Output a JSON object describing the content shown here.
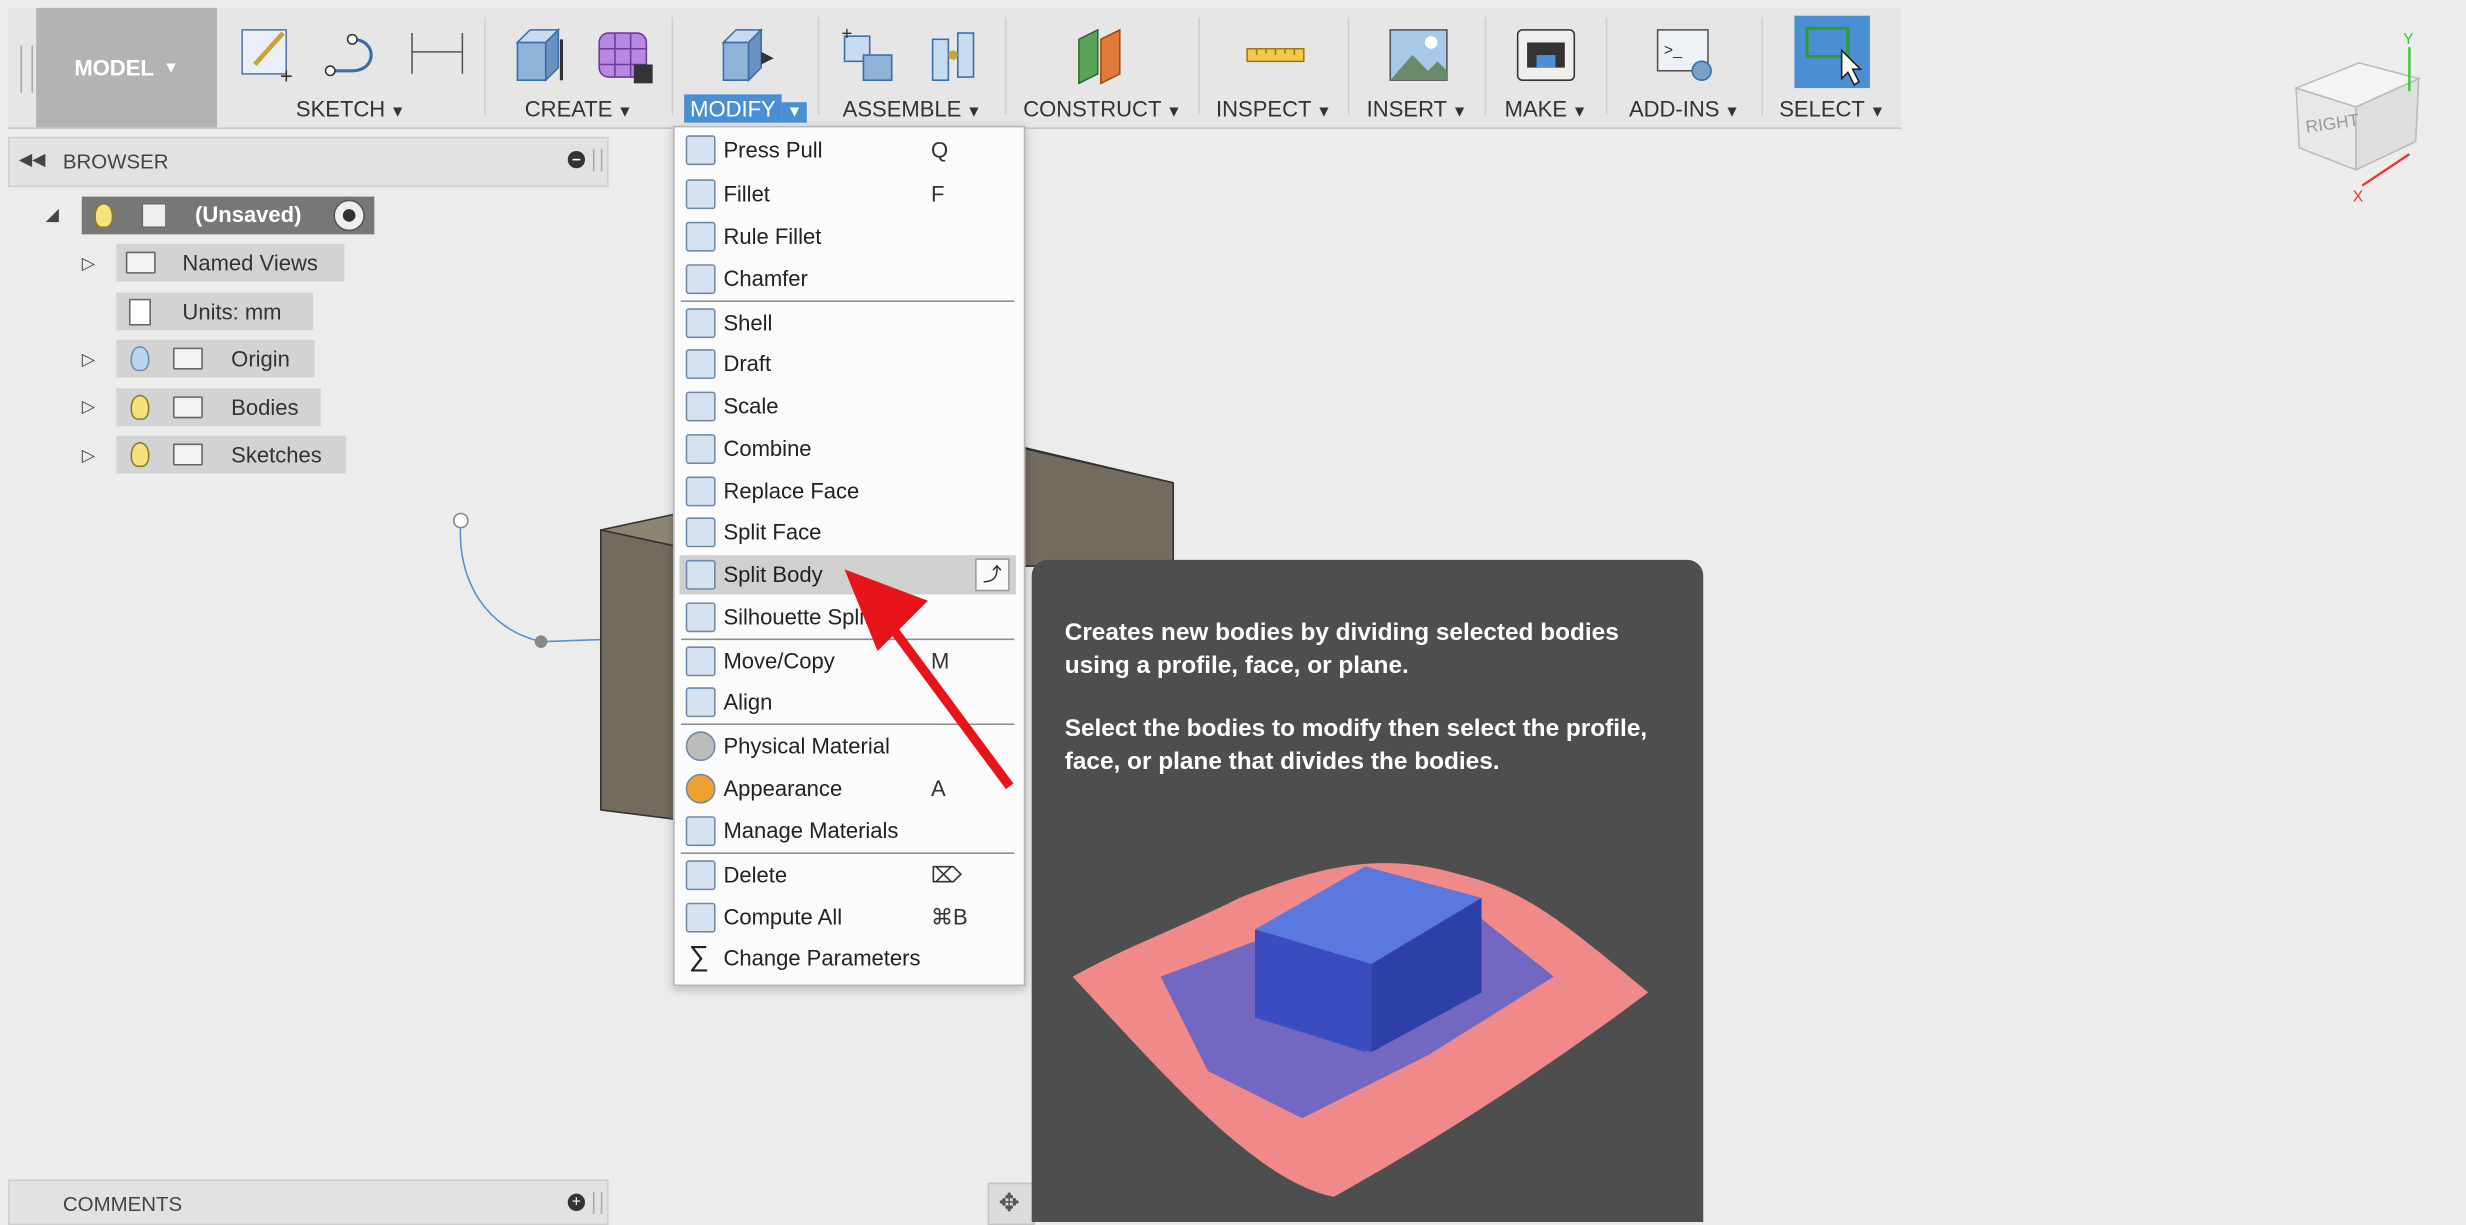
{
  "toolbar": {
    "workspace": "MODEL",
    "groups": [
      {
        "label": "SKETCH"
      },
      {
        "label": "CREATE"
      },
      {
        "label": "MODIFY"
      },
      {
        "label": "ASSEMBLE"
      },
      {
        "label": "CONSTRUCT"
      },
      {
        "label": "INSPECT"
      },
      {
        "label": "INSERT"
      },
      {
        "label": "MAKE"
      },
      {
        "label": "ADD-INS"
      },
      {
        "label": "SELECT"
      }
    ]
  },
  "browser": {
    "title": "BROWSER",
    "root": "(Unsaved)",
    "items": [
      {
        "label": "Named Views"
      },
      {
        "label": "Units: mm"
      },
      {
        "label": "Origin"
      },
      {
        "label": "Bodies"
      },
      {
        "label": "Sketches"
      }
    ]
  },
  "comments": {
    "title": "COMMENTS"
  },
  "menu": {
    "items": [
      {
        "label": "Press Pull",
        "shortcut": "Q"
      },
      {
        "label": "Fillet",
        "shortcut": "F"
      },
      {
        "label": "Rule Fillet",
        "shortcut": ""
      },
      {
        "label": "Chamfer",
        "shortcut": ""
      },
      {
        "label": "Shell",
        "shortcut": ""
      },
      {
        "label": "Draft",
        "shortcut": ""
      },
      {
        "label": "Scale",
        "shortcut": ""
      },
      {
        "label": "Combine",
        "shortcut": ""
      },
      {
        "label": "Replace Face",
        "shortcut": ""
      },
      {
        "label": "Split Face",
        "shortcut": ""
      },
      {
        "label": "Split Body",
        "shortcut": ""
      },
      {
        "label": "Silhouette Split",
        "shortcut": ""
      },
      {
        "label": "Move/Copy",
        "shortcut": "M"
      },
      {
        "label": "Align",
        "shortcut": ""
      },
      {
        "label": "Physical Material",
        "shortcut": ""
      },
      {
        "label": "Appearance",
        "shortcut": "A"
      },
      {
        "label": "Manage Materials",
        "shortcut": ""
      },
      {
        "label": "Delete",
        "shortcut": "⌦"
      },
      {
        "label": "Compute All",
        "shortcut": "⌘B"
      },
      {
        "label": "Change Parameters",
        "shortcut": ""
      }
    ]
  },
  "tooltip": {
    "line1": "Creates new bodies by dividing selected bodies using a profile, face, or plane.",
    "line2": "Select the bodies to modify then select the profile, face, or plane that divides the bodies."
  },
  "viewcube": {
    "face": "RIGHT",
    "axis_y": "Y",
    "axis_x": "X"
  },
  "colors": {
    "accent": "#4a8fd4",
    "tooltip_bg": "#4e4e4e",
    "arrow": "#e8141b"
  }
}
